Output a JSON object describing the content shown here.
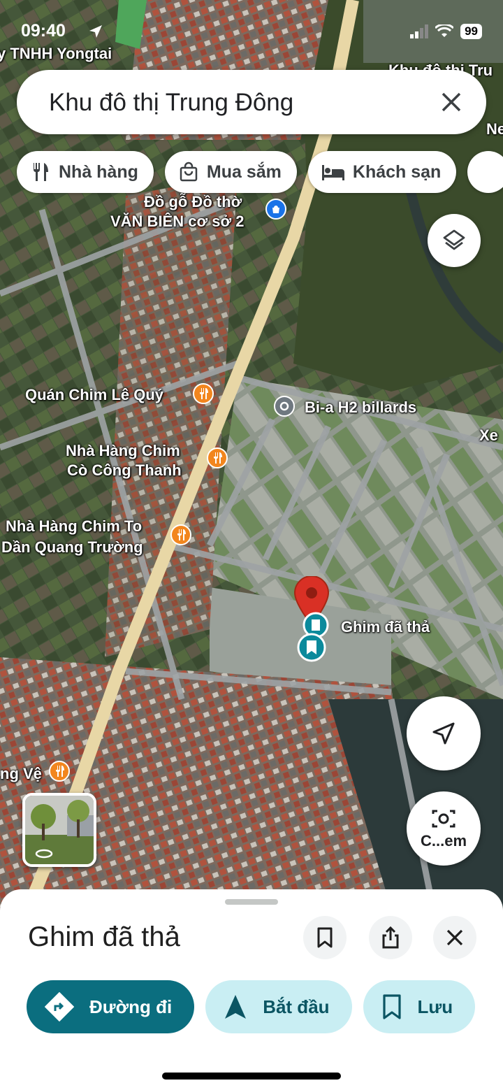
{
  "status_bar": {
    "time": "09:40",
    "battery": "99"
  },
  "search": {
    "query": "Khu đô thị Trung Đông"
  },
  "chips": [
    {
      "label": "Nhà hàng",
      "icon": "fork-knife-icon"
    },
    {
      "label": "Mua sắm",
      "icon": "shopping-bag-icon"
    },
    {
      "label": "Khách sạn",
      "icon": "bed-icon"
    }
  ],
  "map": {
    "labels": {
      "top_left": "y TNHH Yongtai",
      "top_right": "Khu đô thị Tru",
      "ne": "Ne",
      "xe": "Xe",
      "do_go_1": "Đồ gỗ Đồ thờ",
      "do_go_2": "VĂN BIÊN cơ sở 2",
      "quan_chim": "Quán Chim Lê Quý",
      "bia": "Bi-a H2 billards",
      "nha_hang_cong_1": "Nhà Hàng Chim",
      "nha_hang_cong_2": "Cò Công Thanh",
      "nha_hang_to_1": "Nhà Hàng Chim To",
      "nha_hang_to_2": "Dần Quang Trường",
      "pin": "Ghim đã thả",
      "ng_ve": "ng Vệ"
    },
    "lens_label": "C...em",
    "accent_pin": "#d93025",
    "accent_teal": "#0b8a9c"
  },
  "sheet": {
    "title": "Ghim đã thả",
    "actions": {
      "directions": "Đường đi",
      "start": "Bắt đầu",
      "save": "Lưu"
    }
  }
}
